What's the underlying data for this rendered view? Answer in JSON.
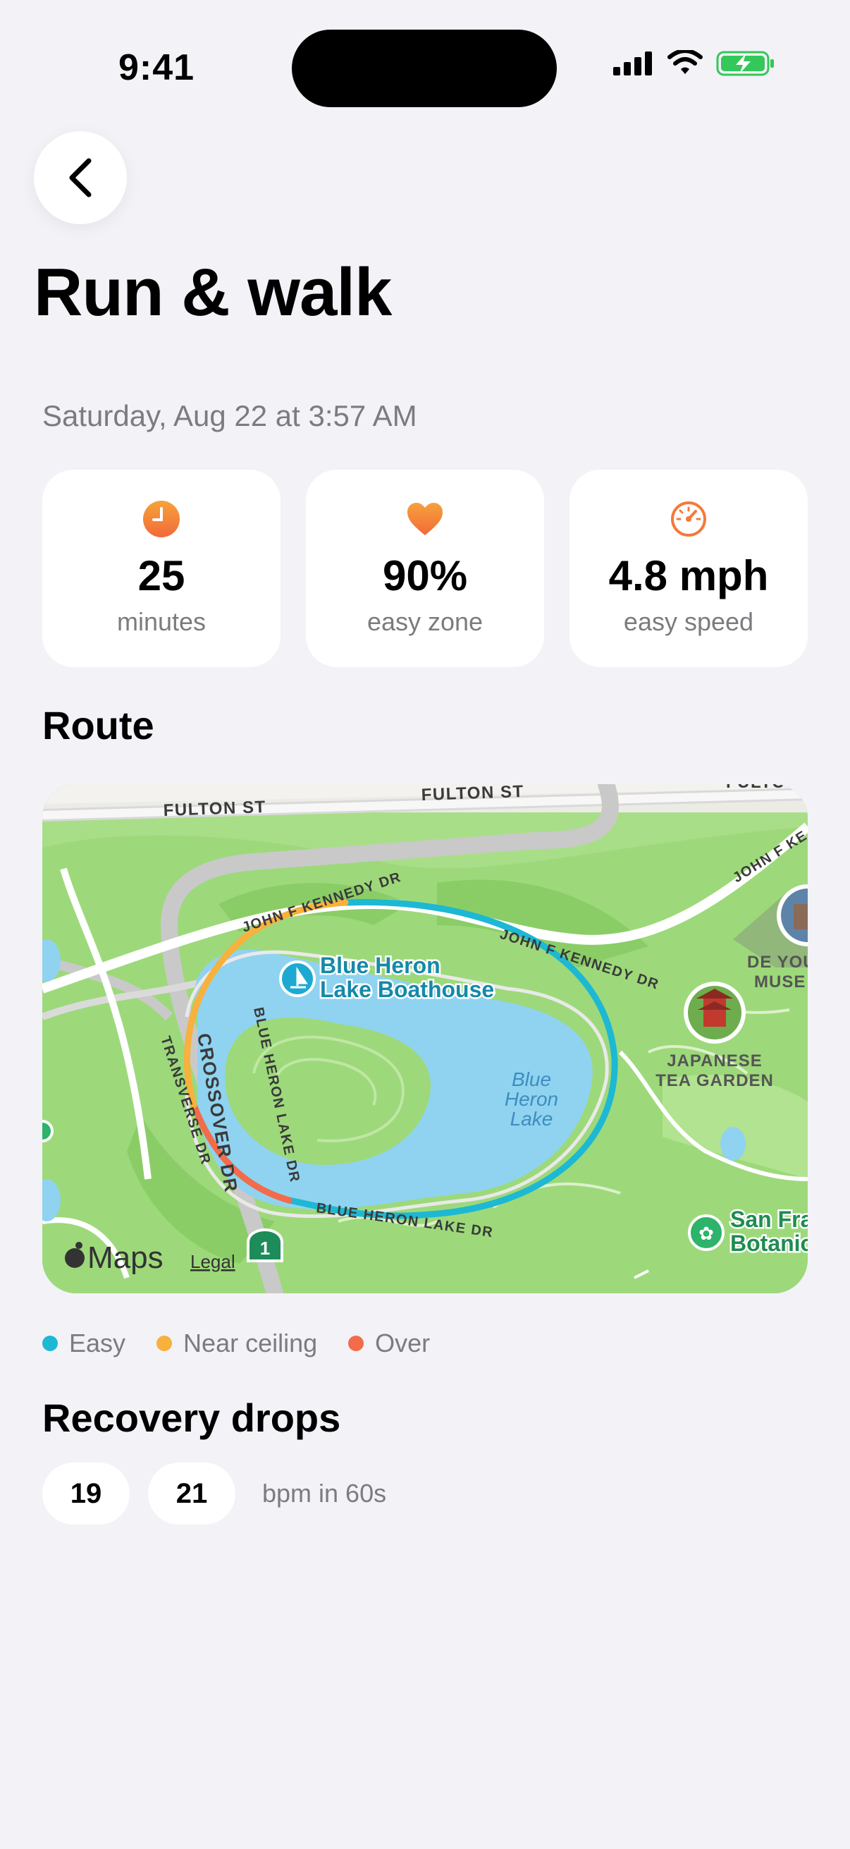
{
  "status_bar": {
    "time": "9:41"
  },
  "header": {
    "title": "Run & walk"
  },
  "workout": {
    "date": "Saturday, Aug 22 at 3:57 AM"
  },
  "stats": [
    {
      "icon": "clock-icon",
      "value": "25",
      "label": "minutes",
      "color": "#F5793B"
    },
    {
      "icon": "heart-icon",
      "value": "90%",
      "label": "easy zone",
      "color": "#F5793B"
    },
    {
      "icon": "speedometer-icon",
      "value": "4.8 mph",
      "label": "easy speed",
      "color": "#F5793B"
    }
  ],
  "route": {
    "title": "Route",
    "map": {
      "streets": [
        "FULTON ST",
        "FULTON ST",
        "FULTO",
        "JOHN F KENNEDY DR",
        "JOHN F KENNEDY DR",
        "JOHN F KE",
        "BLUE HERON LAKE DR",
        "BLUE HERON LAKE DR",
        "CROSSOVER DR",
        "TRANSVERSE DR"
      ],
      "pois": [
        {
          "line1": "Blue Heron",
          "line2": "Lake Boathouse"
        },
        {
          "line1": "JAPANESE",
          "line2": "TEA GARDEN"
        },
        {
          "line1": "DE YOU",
          "line2": "MUSE"
        },
        {
          "line1": "San Fra",
          "line2": "Botanic"
        }
      ],
      "lake": [
        "Blue",
        "Heron",
        "Lake"
      ],
      "highway_shield": "1",
      "attribution": "Maps",
      "legal": "Legal"
    },
    "legend": [
      {
        "label": "Easy",
        "color": "#1DB8D3"
      },
      {
        "label": "Near ceiling",
        "color": "#F7B13C"
      },
      {
        "label": "Over",
        "color": "#F26B4A"
      }
    ]
  },
  "recovery": {
    "title": "Recovery drops",
    "values": [
      "19",
      "21"
    ],
    "unit": "bpm in 60s"
  }
}
